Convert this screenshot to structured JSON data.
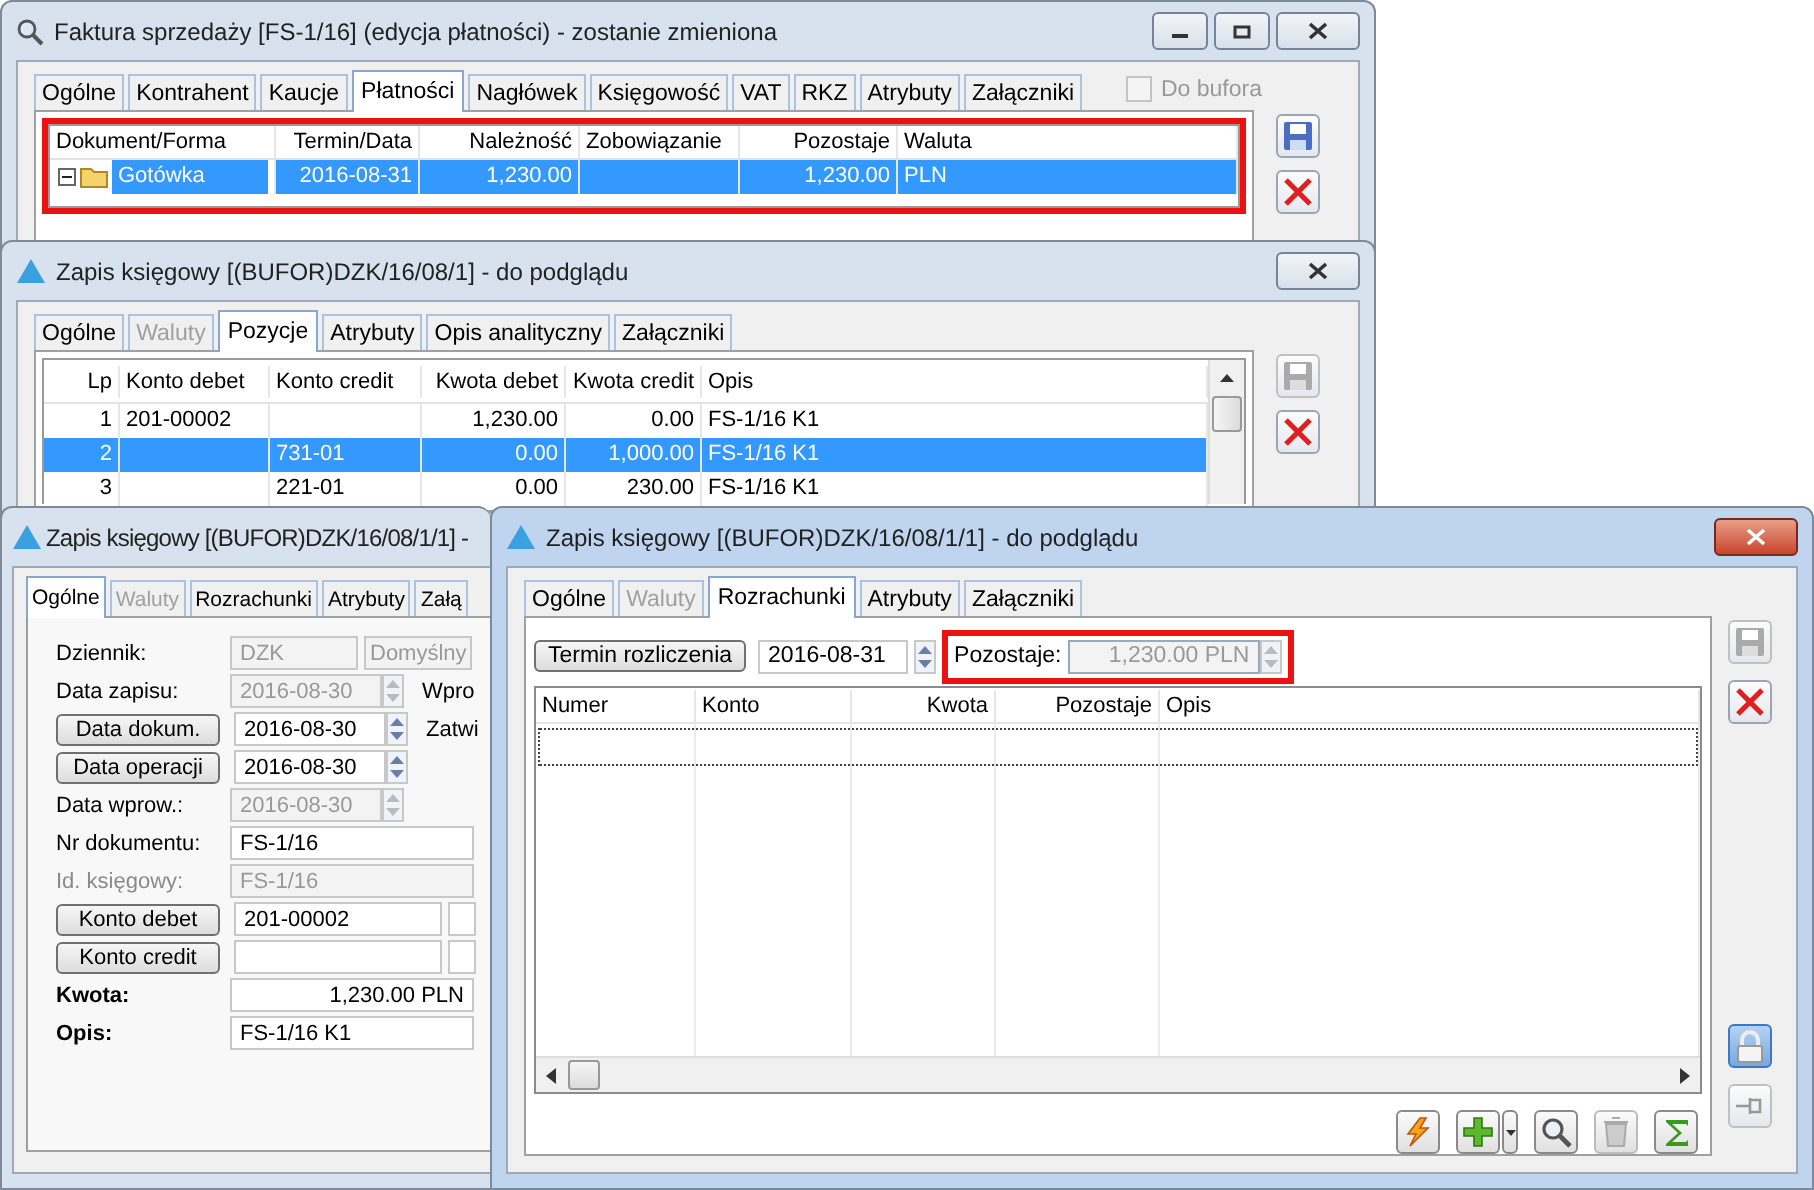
{
  "invoice_window": {
    "title": "Faktura sprzedaży [FS-1/16] (edycja płatności) - zostanie zmieniona",
    "tabs": [
      {
        "label": "Ogólne",
        "selected": false,
        "disabled": false
      },
      {
        "label": "Kontrahent",
        "selected": false,
        "disabled": false
      },
      {
        "label": "Kaucje",
        "selected": false,
        "disabled": false
      },
      {
        "label": "Płatności",
        "selected": true,
        "disabled": false
      },
      {
        "label": "Nagłówek",
        "selected": false,
        "disabled": false
      },
      {
        "label": "Księgowość",
        "selected": false,
        "disabled": false
      },
      {
        "label": "VAT",
        "selected": false,
        "disabled": false
      },
      {
        "label": "RKZ",
        "selected": false,
        "disabled": false
      },
      {
        "label": "Atrybuty",
        "selected": false,
        "disabled": false
      },
      {
        "label": "Załączniki",
        "selected": false,
        "disabled": false
      }
    ],
    "checkbox": {
      "label": "Do bufora",
      "checked": false,
      "disabled": true
    },
    "table": {
      "highlighted": true,
      "columns": [
        "Dokument/Forma",
        "Termin/Data",
        "Należność",
        "Zobowiązanie",
        "Pozostaje",
        "Waluta"
      ],
      "rows": [
        {
          "cells": [
            "Gotówka",
            "2016-08-31",
            "1,230.00",
            "",
            "1,230.00",
            "PLN"
          ],
          "selected": true,
          "expanded": true
        }
      ]
    },
    "buttons": [
      {
        "kind": "save",
        "disabled": false
      },
      {
        "kind": "cancel",
        "disabled": false
      }
    ]
  },
  "entry_window": {
    "title": "Zapis księgowy [(BUFOR)DZK/16/08/1] - do podglądu",
    "tabs": [
      {
        "label": "Ogólne",
        "selected": false,
        "disabled": false
      },
      {
        "label": "Waluty",
        "selected": false,
        "disabled": true
      },
      {
        "label": "Pozycje",
        "selected": true,
        "disabled": false
      },
      {
        "label": "Atrybuty",
        "selected": false,
        "disabled": false
      },
      {
        "label": "Opis analityczny",
        "selected": false,
        "disabled": false
      },
      {
        "label": "Załączniki",
        "selected": false,
        "disabled": false
      }
    ],
    "table": {
      "columns": [
        "Lp",
        "Konto debet",
        "Konto credit",
        "Kwota debet",
        "Kwota credit",
        "Opis"
      ],
      "rows": [
        {
          "cells": [
            "1",
            "201-00002",
            "",
            "1,230.00",
            "0.00",
            "FS-1/16 K1"
          ],
          "selected": false
        },
        {
          "cells": [
            "2",
            "",
            "731-01",
            "0.00",
            "1,000.00",
            "FS-1/16 K1"
          ],
          "selected": true
        },
        {
          "cells": [
            "3",
            "",
            "221-01",
            "0.00",
            "230.00",
            "FS-1/16 K1"
          ],
          "selected": false
        }
      ]
    },
    "buttons": [
      {
        "kind": "save",
        "disabled": true
      },
      {
        "kind": "cancel",
        "disabled": false
      }
    ]
  },
  "entry_detail_window": {
    "title": "Zapis księgowy [(BUFOR)DZK/16/08/1/1] -",
    "tabs": [
      {
        "label": "Ogólne",
        "selected": true,
        "disabled": false
      },
      {
        "label": "Waluty",
        "selected": false,
        "disabled": true
      },
      {
        "label": "Rozrachunki",
        "selected": false,
        "disabled": false
      },
      {
        "label": "Atrybuty",
        "selected": false,
        "disabled": false
      },
      {
        "label": "Załą",
        "selected": false,
        "disabled": false
      }
    ],
    "form": [
      {
        "kind": "text",
        "label": "Dziennik:",
        "value": "DZK",
        "disabled": true,
        "extra_value": "Domyślny"
      },
      {
        "kind": "text",
        "label": "Data zapisu:",
        "value": "2016-08-30",
        "spin": true,
        "disabled": true,
        "side": "Wpro"
      },
      {
        "kind": "button",
        "label": "Data dokum.",
        "value": "2016-08-30",
        "spin": true,
        "disabled": false,
        "side": "Zatwi"
      },
      {
        "kind": "button",
        "label": "Data operacji",
        "value": "2016-08-30",
        "spin": true,
        "disabled": false
      },
      {
        "kind": "text",
        "label": "Data wprow.:",
        "value": "2016-08-30",
        "spin": true,
        "disabled": true
      },
      {
        "kind": "text",
        "label": "Nr dokumentu:",
        "value": "FS-1/16",
        "disabled": false
      },
      {
        "kind": "muted",
        "label": "Id. księgowy:",
        "value": "FS-1/16",
        "disabled": true
      },
      {
        "kind": "account",
        "label": "Konto debet",
        "value": "201-00002",
        "disabled": false
      },
      {
        "kind": "account",
        "label": "Konto credit",
        "disabled": false
      },
      {
        "kind": "total",
        "label": "Kwota:",
        "value": "1,230.00 PLN",
        "disabled": false
      },
      {
        "kind": "bold",
        "label": "Opis:",
        "value": "FS-1/16 K1",
        "disabled": false
      }
    ]
  },
  "settlement_window": {
    "title": "Zapis księgowy [(BUFOR)DZK/16/08/1/1] - do podglądu",
    "tabs": [
      {
        "label": "Ogólne",
        "selected": false,
        "disabled": false
      },
      {
        "label": "Waluty",
        "selected": false,
        "disabled": true
      },
      {
        "label": "Rozrachunki",
        "selected": true,
        "disabled": false
      },
      {
        "label": "Atrybuty",
        "selected": false,
        "disabled": false
      },
      {
        "label": "Załączniki",
        "selected": false,
        "disabled": false
      }
    ],
    "term_button": "Termin rozliczenia",
    "term_date": "2016-08-31",
    "remaining": {
      "label": "Pozostaje:",
      "value": "1,230.00 PLN",
      "highlighted": true,
      "disabled": true
    },
    "table": {
      "columns": [
        "Numer",
        "Konto",
        "Kwota",
        "Pozostaje",
        "Opis"
      ]
    },
    "toolbar": [
      {
        "kind": "lightning",
        "disabled": false
      },
      {
        "kind": "add",
        "disabled": false
      },
      {
        "kind": "dropdown",
        "disabled": false
      },
      {
        "kind": "search",
        "disabled": false
      },
      {
        "kind": "delete",
        "disabled": true
      },
      {
        "kind": "sum",
        "disabled": false
      }
    ],
    "side_buttons": [
      {
        "kind": "save",
        "disabled": true
      },
      {
        "kind": "cancel",
        "disabled": false
      },
      {
        "kind": "lock",
        "disabled": false
      },
      {
        "kind": "pin",
        "disabled": true
      }
    ]
  }
}
